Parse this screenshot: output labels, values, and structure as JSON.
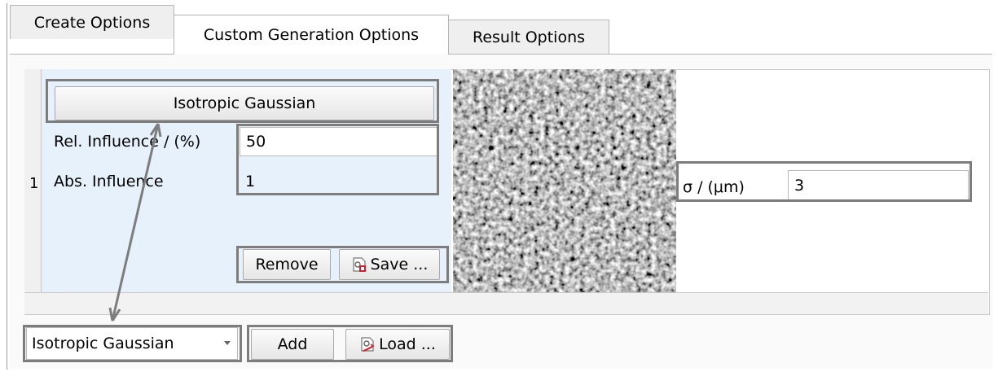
{
  "tabs": [
    {
      "label": "Create Options",
      "active": false
    },
    {
      "label": "Custom Generation Options",
      "active": true
    },
    {
      "label": "Result Options",
      "active": false
    }
  ],
  "row": {
    "number": "1",
    "type_button_label": "Isotropic Gaussian",
    "rel_influence_label": "Rel. Influence / (%)",
    "rel_influence_value": "50",
    "abs_influence_label": "Abs. Influence",
    "abs_influence_value": "1",
    "remove_label": "Remove",
    "save_label": "Save ...",
    "save_icon": "save-settings-icon",
    "preview_image": "noise-preview",
    "sigma_label": "σ / (μm)",
    "sigma_value": "3"
  },
  "bottom": {
    "type_select_value": "Isotropic Gaussian",
    "add_label": "Add",
    "load_label": "Load ...",
    "load_icon": "load-settings-icon"
  },
  "annotation_color": "#7d7d7d"
}
